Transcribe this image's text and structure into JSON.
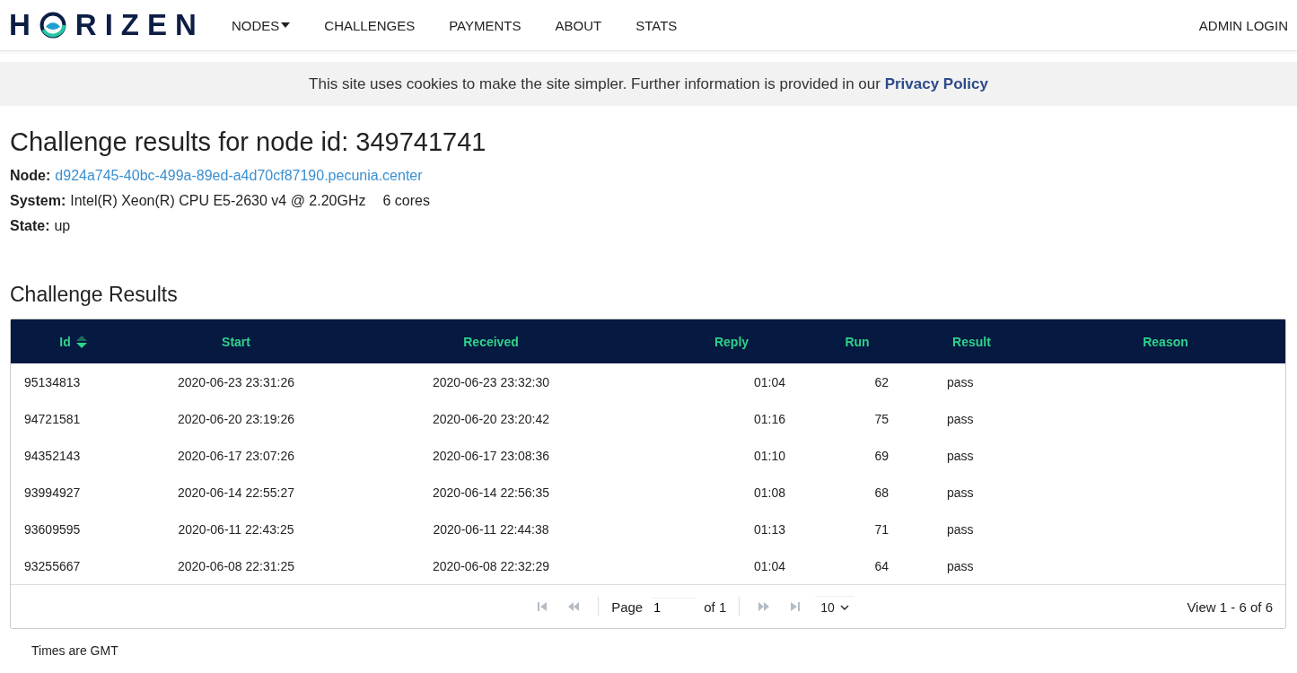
{
  "logo": {
    "before": "H",
    "after": "RIZEN"
  },
  "nav": [
    {
      "label": "NODES",
      "dropdown": true
    },
    {
      "label": "CHALLENGES",
      "dropdown": false
    },
    {
      "label": "PAYMENTS",
      "dropdown": false
    },
    {
      "label": "ABOUT",
      "dropdown": false
    },
    {
      "label": "STATS",
      "dropdown": false
    }
  ],
  "admin_login": "ADMIN LOGIN",
  "cookie_banner": "This site uses cookies to make the site simpler. Further information is provided in our **Privacy Policy**",
  "title": "Challenge results for node id: 349741741",
  "details": [
    {
      "label": "Node:",
      "value": "d924a745-40bc-499a-89ed-a4d70cf87190.pecunia.center",
      "kind": "link"
    },
    {
      "label": "System:",
      "value": "Intel(R) Xeon(R) CPU E5-2630 v4 @ 2.20GHz",
      "extra": "6 cores",
      "kind": "text"
    },
    {
      "label": "State:",
      "value": "up",
      "kind": "text"
    }
  ],
  "section_title": "Challenge Results",
  "table": {
    "columns": [
      {
        "label": "Id",
        "sorted": true
      },
      {
        "label": "Start",
        "sorted": false
      },
      {
        "label": "Received",
        "sorted": false
      },
      {
        "label": "Reply",
        "sorted": false
      },
      {
        "label": "Run",
        "sorted": false
      },
      {
        "label": "Result",
        "sorted": false
      },
      {
        "label": "Reason",
        "sorted": false
      }
    ],
    "rows": [
      [
        "95134813",
        "2020-06-23 23:31:26",
        "2020-06-23 23:32:30",
        "01:04",
        "62",
        "pass"
      ],
      [
        "94721581",
        "2020-06-20 23:19:26",
        "2020-06-20 23:20:42",
        "01:16",
        "75",
        "pass"
      ],
      [
        "94352143",
        "2020-06-17 23:07:26",
        "2020-06-17 23:08:36",
        "01:10",
        "69",
        "pass"
      ],
      [
        "93994927",
        "2020-06-14 22:55:27",
        "2020-06-14 22:56:35",
        "01:08",
        "68",
        "pass"
      ],
      [
        "93609595",
        "2020-06-11 22:43:25",
        "2020-06-11 22:44:38",
        "01:13",
        "71",
        "pass"
      ],
      [
        "93255667",
        "2020-06-08 22:31:25",
        "2020-06-08 22:32:29",
        "01:04",
        "64",
        "pass"
      ]
    ]
  },
  "pager": {
    "first_disabled": true,
    "prev_disabled": true,
    "page_label": "Page",
    "page_value": "1",
    "of_label": "of 1",
    "next_disabled": true,
    "last_disabled": true,
    "page_size": "10",
    "view": "View 1 - 6 of 6"
  },
  "footnote": "Times are GMT"
}
